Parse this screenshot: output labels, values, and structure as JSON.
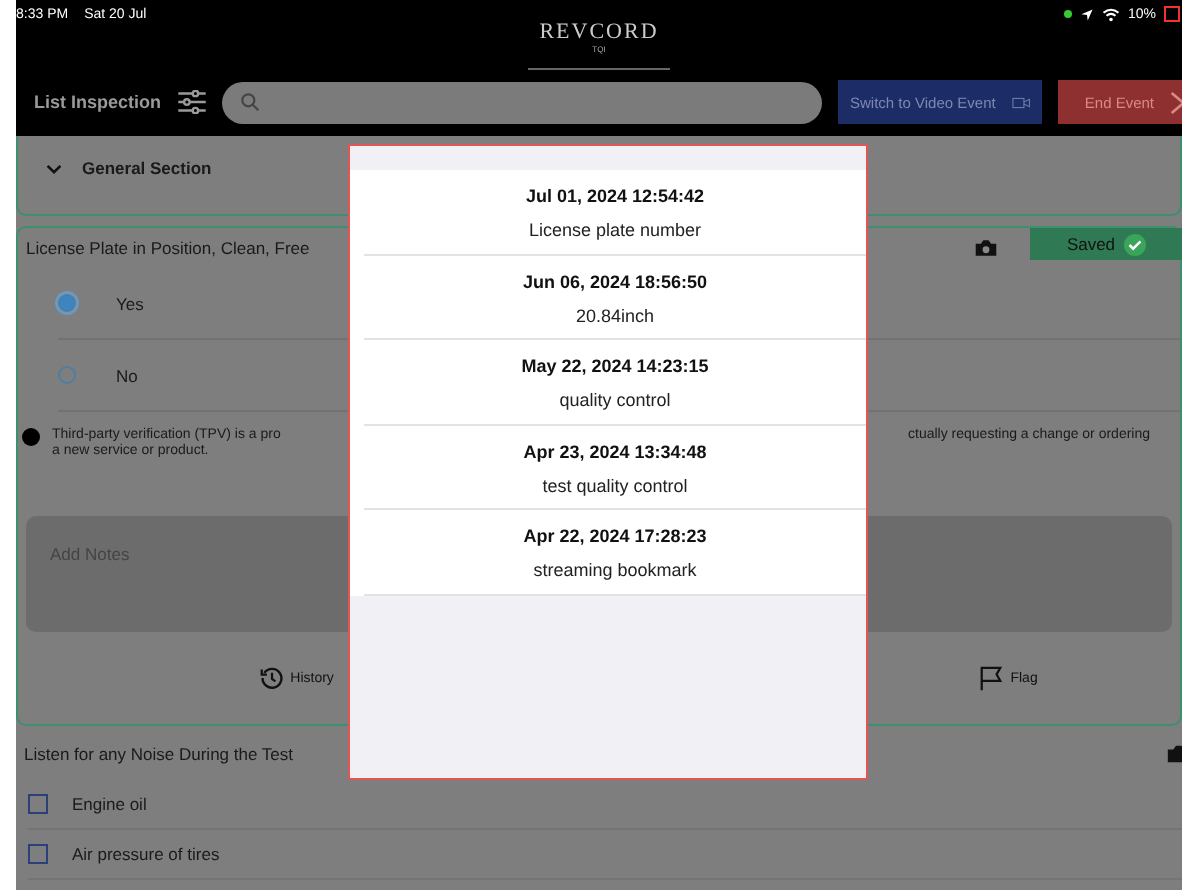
{
  "status_bar": {
    "time": "8:33 PM",
    "date": "Sat 20 Jul",
    "battery": "10%"
  },
  "header": {
    "logo": "REVCORD",
    "logo_sub": "TQI"
  },
  "toolbar": {
    "title": "List Inspection",
    "buttons": [
      {
        "label": "Switch to Video Event",
        "kind": "video"
      },
      {
        "label": "End Event",
        "kind": "end"
      }
    ]
  },
  "general_section": {
    "title": "General Section",
    "expanded": true
  },
  "question": {
    "title": "License Plate in Position, Clean, Free",
    "status": "Saved",
    "options": [
      {
        "label": "Yes",
        "selected": true
      },
      {
        "label": "No",
        "selected": false
      }
    ],
    "info": {
      "left_lines": [
        "Third-party verification (TPV) is a pro",
        "a new service or product."
      ],
      "right_lines": [
        "ctually requesting a change or ordering"
      ]
    },
    "notes_placeholder": "Add Notes",
    "actions": [
      {
        "label": "History",
        "kind": "history"
      },
      {
        "label": "Flag",
        "kind": "flag"
      }
    ]
  },
  "question_2": {
    "title": "Listen for any Noise During the Test",
    "items": [
      {
        "label": "Engine oil",
        "checked": false
      },
      {
        "label": "Air pressure of tires",
        "checked": false
      }
    ]
  },
  "history_popup": {
    "entries": [
      {
        "date": "Jul 01, 2024 12:54:42",
        "note": "License plate number"
      },
      {
        "date": "Jun 06, 2024 18:56:50",
        "note": "20.84inch"
      },
      {
        "date": "May 22, 2024 14:23:15",
        "note": "quality control"
      },
      {
        "date": "Apr 23, 2024 13:34:48",
        "note": "test quality control"
      },
      {
        "date": "Apr 22, 2024 17:28:23",
        "note": "streaming bookmark"
      }
    ]
  }
}
